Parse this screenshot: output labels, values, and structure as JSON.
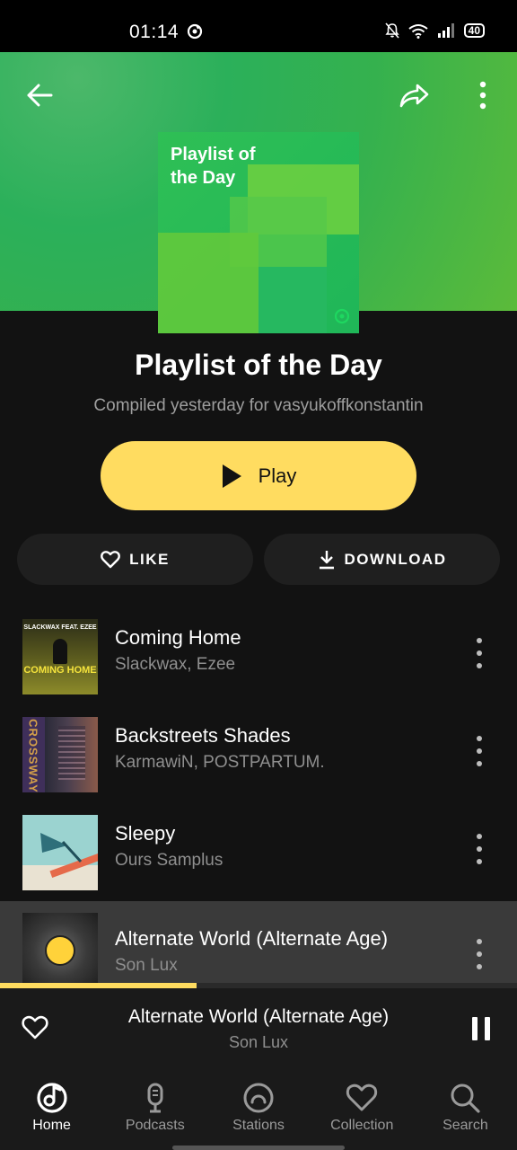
{
  "status_bar": {
    "time": "01:14",
    "battery": "40"
  },
  "cover": {
    "title": "Playlist of the Day"
  },
  "playlist": {
    "title": "Playlist of the Day",
    "subtitle": "Compiled yesterday for vasyukoffkonstantin"
  },
  "actions": {
    "play_label": "Play",
    "like_label": "LIKE",
    "download_label": "DOWNLOAD"
  },
  "tracks": [
    {
      "title": "Coming Home",
      "artist": "Slackwax, Ezee",
      "art_text_top": "SLACKWAX FEAT. EZEE",
      "art_text_bottom": "COMING HOME"
    },
    {
      "title": "Backstreets Shades",
      "artist": "KarmawiN, POSTPARTUM.",
      "art_text": "CROSSWAY"
    },
    {
      "title": "Sleepy",
      "artist": "Ours Samplus"
    },
    {
      "title": "Alternate World (Alternate Age)",
      "artist": "Son Lux"
    }
  ],
  "now_playing": {
    "title": "Alternate World (Alternate Age)",
    "artist": "Son Lux",
    "progress": 0.38
  },
  "nav": [
    {
      "label": "Home",
      "icon": "music-note-icon",
      "active": true
    },
    {
      "label": "Podcasts",
      "icon": "microphone-icon",
      "active": false
    },
    {
      "label": "Stations",
      "icon": "radio-icon",
      "active": false
    },
    {
      "label": "Collection",
      "icon": "heart-icon",
      "active": false
    },
    {
      "label": "Search",
      "icon": "search-icon",
      "active": false
    }
  ],
  "colors": {
    "accent": "#ffdc60",
    "hero_green": "#2bb05a",
    "background": "#121212"
  }
}
